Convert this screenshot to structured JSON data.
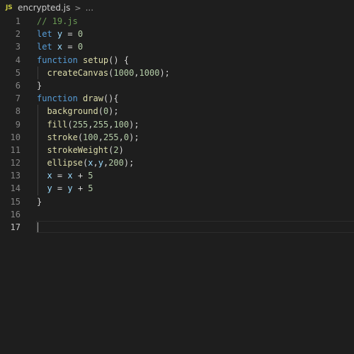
{
  "breadcrumb": {
    "icon": "js-icon",
    "icon_label": "JS",
    "file": "encrypted.js",
    "separator": ">",
    "more": "..."
  },
  "colors": {
    "background": "#1e1e1e",
    "keyword": "#569cd6",
    "variable": "#9cdcfe",
    "function": "#dcdcaa",
    "number": "#b5cea8",
    "comment": "#6a9955",
    "text": "#d4d4d4",
    "js_icon": "#cbcb41"
  },
  "editor": {
    "active_line": 17,
    "lines": [
      {
        "number": "1",
        "tokens": [
          {
            "t": "// 19.js",
            "c": "comment"
          }
        ]
      },
      {
        "number": "2",
        "tokens": [
          {
            "t": "let",
            "c": "keyword"
          },
          {
            "t": " ",
            "c": "text"
          },
          {
            "t": "y",
            "c": "variable"
          },
          {
            "t": " = ",
            "c": "text"
          },
          {
            "t": "0",
            "c": "number"
          }
        ]
      },
      {
        "number": "3",
        "tokens": [
          {
            "t": "let",
            "c": "keyword"
          },
          {
            "t": " ",
            "c": "text"
          },
          {
            "t": "x",
            "c": "variable"
          },
          {
            "t": " = ",
            "c": "text"
          },
          {
            "t": "0",
            "c": "number"
          }
        ]
      },
      {
        "number": "4",
        "tokens": [
          {
            "t": "function",
            "c": "keyword"
          },
          {
            "t": " ",
            "c": "text"
          },
          {
            "t": "setup",
            "c": "function"
          },
          {
            "t": "() {",
            "c": "text"
          }
        ]
      },
      {
        "number": "5",
        "indent": true,
        "tokens": [
          {
            "t": "  ",
            "c": "text"
          },
          {
            "t": "createCanvas",
            "c": "function"
          },
          {
            "t": "(",
            "c": "text"
          },
          {
            "t": "1000",
            "c": "number"
          },
          {
            "t": ",",
            "c": "text"
          },
          {
            "t": "1000",
            "c": "number"
          },
          {
            "t": ");",
            "c": "text"
          }
        ]
      },
      {
        "number": "6",
        "tokens": [
          {
            "t": "}",
            "c": "text"
          }
        ]
      },
      {
        "number": "7",
        "tokens": [
          {
            "t": "function",
            "c": "keyword"
          },
          {
            "t": " ",
            "c": "text"
          },
          {
            "t": "draw",
            "c": "function"
          },
          {
            "t": "(){",
            "c": "text"
          }
        ]
      },
      {
        "number": "8",
        "indent": true,
        "tokens": [
          {
            "t": "  ",
            "c": "text"
          },
          {
            "t": "background",
            "c": "function"
          },
          {
            "t": "(",
            "c": "text"
          },
          {
            "t": "0",
            "c": "number"
          },
          {
            "t": ");",
            "c": "text"
          }
        ]
      },
      {
        "number": "9",
        "indent": true,
        "tokens": [
          {
            "t": "  ",
            "c": "text"
          },
          {
            "t": "fill",
            "c": "function"
          },
          {
            "t": "(",
            "c": "text"
          },
          {
            "t": "255",
            "c": "number"
          },
          {
            "t": ",",
            "c": "text"
          },
          {
            "t": "255",
            "c": "number"
          },
          {
            "t": ",",
            "c": "text"
          },
          {
            "t": "100",
            "c": "number"
          },
          {
            "t": ");",
            "c": "text"
          }
        ]
      },
      {
        "number": "10",
        "indent": true,
        "tokens": [
          {
            "t": "  ",
            "c": "text"
          },
          {
            "t": "stroke",
            "c": "function"
          },
          {
            "t": "(",
            "c": "text"
          },
          {
            "t": "100",
            "c": "number"
          },
          {
            "t": ",",
            "c": "text"
          },
          {
            "t": "255",
            "c": "number"
          },
          {
            "t": ",",
            "c": "text"
          },
          {
            "t": "0",
            "c": "number"
          },
          {
            "t": ");",
            "c": "text"
          }
        ]
      },
      {
        "number": "11",
        "indent": true,
        "tokens": [
          {
            "t": "  ",
            "c": "text"
          },
          {
            "t": "strokeWeight",
            "c": "function"
          },
          {
            "t": "(",
            "c": "text"
          },
          {
            "t": "2",
            "c": "number"
          },
          {
            "t": ")",
            "c": "text"
          }
        ]
      },
      {
        "number": "12",
        "indent": true,
        "tokens": [
          {
            "t": "  ",
            "c": "text"
          },
          {
            "t": "ellipse",
            "c": "function"
          },
          {
            "t": "(",
            "c": "text"
          },
          {
            "t": "x",
            "c": "variable"
          },
          {
            "t": ",",
            "c": "text"
          },
          {
            "t": "y",
            "c": "variable"
          },
          {
            "t": ",",
            "c": "text"
          },
          {
            "t": "200",
            "c": "number"
          },
          {
            "t": ");",
            "c": "text"
          }
        ]
      },
      {
        "number": "13",
        "indent": true,
        "tokens": [
          {
            "t": "  ",
            "c": "text"
          },
          {
            "t": "x",
            "c": "variable"
          },
          {
            "t": " = ",
            "c": "text"
          },
          {
            "t": "x",
            "c": "variable"
          },
          {
            "t": " + ",
            "c": "text"
          },
          {
            "t": "5",
            "c": "number"
          }
        ]
      },
      {
        "number": "14",
        "indent": true,
        "tokens": [
          {
            "t": "  ",
            "c": "text"
          },
          {
            "t": "y",
            "c": "variable"
          },
          {
            "t": " = ",
            "c": "text"
          },
          {
            "t": "y",
            "c": "variable"
          },
          {
            "t": " + ",
            "c": "text"
          },
          {
            "t": "5",
            "c": "number"
          }
        ]
      },
      {
        "number": "15",
        "tokens": [
          {
            "t": "}",
            "c": "text"
          }
        ]
      },
      {
        "number": "16",
        "tokens": []
      },
      {
        "number": "17",
        "tokens": []
      }
    ]
  }
}
